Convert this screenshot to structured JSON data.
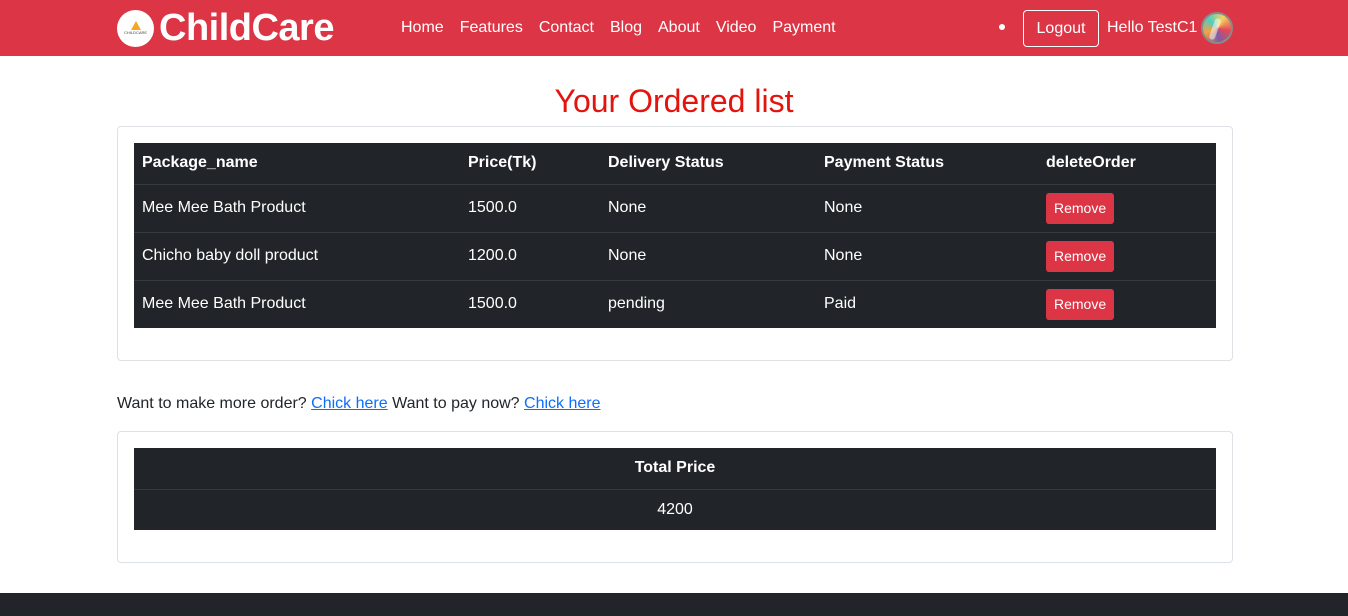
{
  "navbar": {
    "brand": "ChildCare",
    "brand_logo_text": "CHILDCARE",
    "links": [
      "Home",
      "Features",
      "Contact",
      "Blog",
      "About",
      "Video",
      "Payment"
    ],
    "logout_label": "Logout",
    "greeting": "Hello TestC1",
    "colors": {
      "background": "#dc3545",
      "text": "#ffffff"
    }
  },
  "page_title": "Your Ordered list",
  "orders": {
    "headers": [
      "Package_name",
      "Price(Tk)",
      "Delivery Status",
      "Payment Status",
      "deleteOrder"
    ],
    "rows": [
      {
        "package_name": "Mee Mee Bath Product",
        "price": "1500.0",
        "delivery_status": "None",
        "payment_status": "None",
        "action": "Remove"
      },
      {
        "package_name": "Chicho baby doll product",
        "price": "1200.0",
        "delivery_status": "None",
        "payment_status": "None",
        "action": "Remove"
      },
      {
        "package_name": "Mee Mee Bath Product",
        "price": "1500.0",
        "delivery_status": "pending",
        "payment_status": "Paid",
        "action": "Remove"
      }
    ]
  },
  "prompt_line": {
    "order_question": "Want to make more order?",
    "order_link": "Chick here",
    "pay_question": "Want to pay now?",
    "pay_link": "Chick here"
  },
  "total": {
    "header": "Total Price",
    "value": "4200"
  },
  "colors": {
    "accent": "#dc3545",
    "title": "#e3130d",
    "table_bg": "#212529",
    "link": "#0d6efd"
  }
}
